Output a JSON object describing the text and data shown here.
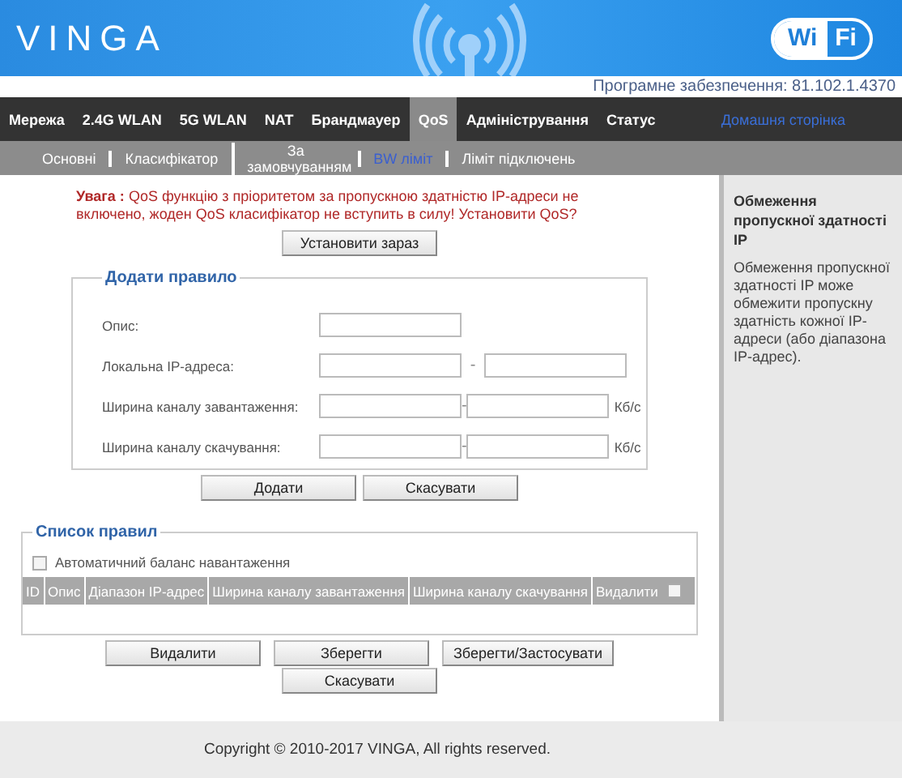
{
  "header": {
    "logo": "VINGA",
    "badge": [
      "Wi",
      "Fi"
    ]
  },
  "firmware": "Програмне забезпечення: 81.102.1.4370",
  "nav": [
    {
      "label": "Мережа",
      "selected": false,
      "kind": "tab"
    },
    {
      "label": "2.4G WLAN",
      "selected": false,
      "kind": "tab"
    },
    {
      "label": "5G WLAN",
      "selected": false,
      "kind": "tab"
    },
    {
      "label": "NAT",
      "selected": false,
      "kind": "tab"
    },
    {
      "label": "Брандмауер",
      "selected": false,
      "kind": "tab"
    },
    {
      "label": "QoS",
      "selected": true,
      "kind": "tab"
    },
    {
      "label": "Адміністрування",
      "selected": false,
      "kind": "tab"
    },
    {
      "label": "Статус",
      "selected": false,
      "kind": "tab"
    },
    {
      "label": "Домашня сторінка",
      "selected": false,
      "kind": "link"
    }
  ],
  "subnav": [
    {
      "label": "Основні",
      "selected": false
    },
    {
      "label": "Класифікатор",
      "selected": false
    },
    {
      "label": "За замовчуванням",
      "selected": false
    },
    {
      "label": "BW ліміт",
      "selected": true
    },
    {
      "label": "Ліміт підключень",
      "selected": false
    }
  ],
  "warning": {
    "prefix": "Увага :",
    "text": "QoS функцію з пріоритетом за пропускною здатністю IP-адреси не включено, жоден QoS класифікатор не вступить в силу! Установити QoS?",
    "button": "Установити зараз"
  },
  "add_rule": {
    "title": "Додати правило",
    "rows": [
      {
        "label": "Опис:"
      },
      {
        "label": "Локальна IP-адреса:",
        "dash": "-"
      },
      {
        "label": "Ширина каналу завантаження:",
        "dash": "-",
        "unit": "Кб/с"
      },
      {
        "label": "Ширина каналу скачування:",
        "dash": "-",
        "unit": "Кб/с"
      }
    ],
    "buttons": [
      "Додати",
      "Скасувати"
    ]
  },
  "rule_list": {
    "title": "Список правил",
    "auto_balance": {
      "label": "Автоматичний баланс навантаження",
      "checked": false
    },
    "columns": [
      {
        "label": "ID"
      },
      {
        "label": "Опис"
      },
      {
        "label": "Діапазон IP-адрес"
      },
      {
        "label": "Ширина каналу завантаження"
      },
      {
        "label": "Ширина каналу скачування"
      },
      {
        "label": "Видалити",
        "checked": false
      }
    ],
    "buttons": [
      "Видалити",
      "Зберегти",
      "Зберегти/Застосувати",
      "Скасувати"
    ]
  },
  "sidebar": {
    "title": "Обмеження пропускної здатності IP",
    "text": "Обмеження пропускної здатності IP може обмежити пропускну здатність кожної IP-адреси (або діапазона IP-адрес)."
  },
  "footer": "Copyright © 2010-2017 VINGA, All rights reserved."
}
